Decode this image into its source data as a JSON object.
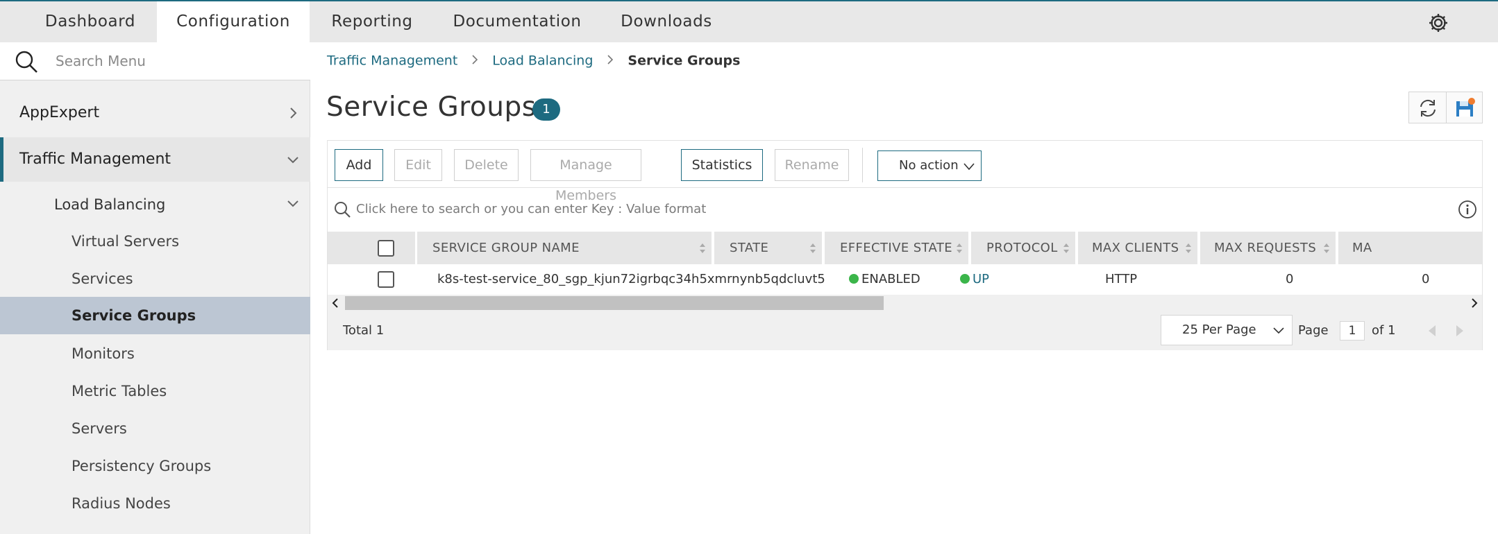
{
  "top_nav": {
    "tabs": [
      {
        "label": "Dashboard",
        "active": false
      },
      {
        "label": "Configuration",
        "active": true
      },
      {
        "label": "Reporting",
        "active": false
      },
      {
        "label": "Documentation",
        "active": false
      },
      {
        "label": "Downloads",
        "active": false
      }
    ],
    "settings_icon": "gear-icon"
  },
  "sidebar": {
    "search_placeholder": "Search Menu",
    "items": [
      {
        "label": "AppExpert",
        "level": 0,
        "chevron": "right"
      },
      {
        "label": "Traffic Management",
        "level": 0,
        "chevron": "down",
        "expanded": true
      },
      {
        "label": "Load Balancing",
        "level": 1,
        "chevron": "down"
      },
      {
        "label": "Virtual Servers",
        "level": 2
      },
      {
        "label": "Services",
        "level": 2
      },
      {
        "label": "Service Groups",
        "level": 2,
        "selected": true
      },
      {
        "label": "Monitors",
        "level": 2
      },
      {
        "label": "Metric Tables",
        "level": 2
      },
      {
        "label": "Servers",
        "level": 2
      },
      {
        "label": "Persistency Groups",
        "level": 2
      },
      {
        "label": "Radius Nodes",
        "level": 2
      }
    ]
  },
  "breadcrumb": {
    "items": [
      "Traffic Management",
      "Load Balancing"
    ],
    "current": "Service Groups"
  },
  "page": {
    "title": "Service Groups",
    "count": "1"
  },
  "toolbar": {
    "add": "Add",
    "edit": "Edit",
    "delete": "Delete",
    "manage_members": "Manage Members",
    "statistics": "Statistics",
    "rename": "Rename",
    "action_select": "No action"
  },
  "search": {
    "placeholder": "Click here to search or you can enter Key : Value format"
  },
  "table": {
    "columns": [
      "SERVICE GROUP NAME",
      "STATE",
      "EFFECTIVE STATE",
      "PROTOCOL",
      "MAX CLIENTS",
      "MAX REQUESTS",
      "MA"
    ],
    "rows": [
      {
        "name": "k8s-test-service_80_sgp_kjun72igrbqc34h5xmrnynb5qdcluvt5",
        "state": "ENABLED",
        "effective_state": "UP",
        "protocol": "HTTP",
        "max_clients": "0",
        "max_requests": "0"
      }
    ]
  },
  "footer": {
    "total": "Total 1",
    "per_page": "25 Per Page",
    "page_label": "Page",
    "page_value": "1",
    "of_label": "of 1"
  },
  "colors": {
    "accent": "#1d6a80",
    "status_green": "#3bb54a",
    "selected_item": "#bcc6d3",
    "save_dot": "#f07c2e"
  }
}
